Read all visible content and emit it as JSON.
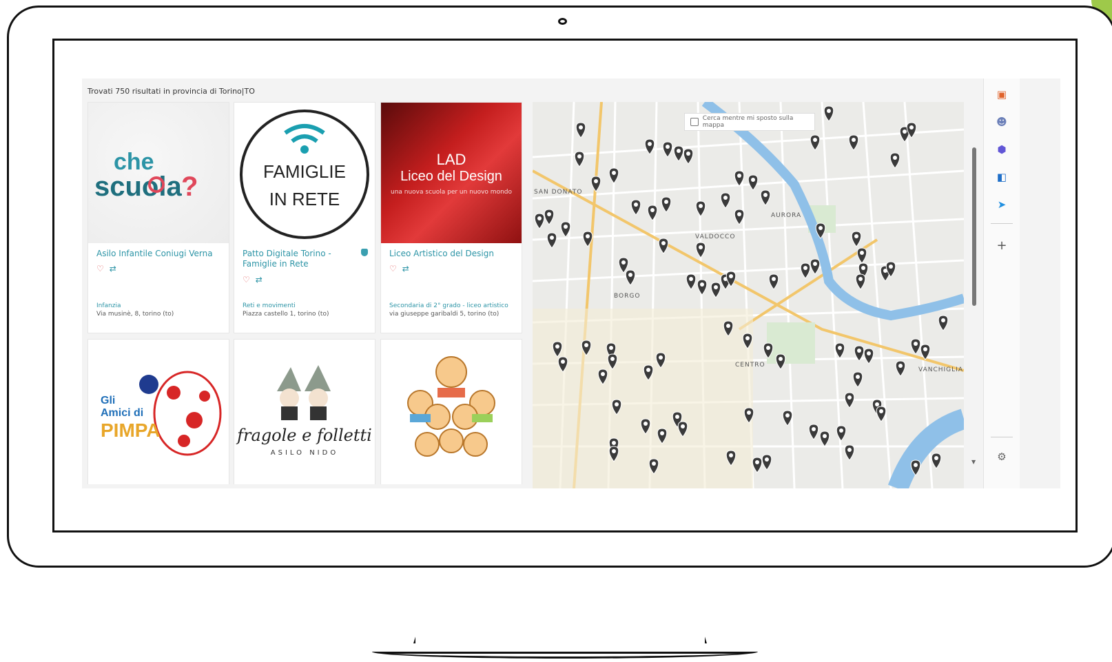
{
  "results": {
    "title": "Trovati 750 risultati in provincia di Torino|TO"
  },
  "cards": [
    {
      "title": "Asilo Infantile Coniugi Verna",
      "likes": "♡",
      "shares": "⇄",
      "category": "Infanzia",
      "address": "Via musinè, 8, torino (to)",
      "logo_text": "che scuola?"
    },
    {
      "title": "Patto Digitale Torino - Famiglie in Rete",
      "likes": "♡",
      "shares": "⇄",
      "category": "Reti e movimenti",
      "address": "Piazza castello 1, torino (to)",
      "logo_line1": "FAMIGLIE",
      "logo_line2": "IN RETE"
    },
    {
      "title": "Liceo Artistico del Design",
      "likes": "♡",
      "shares": "⇄",
      "category": "Secondaria di 2° grado - liceo artistico",
      "address": "via giuseppe garibaldi 5, torino (to)",
      "logo_line1": "LAD",
      "logo_line2": "Liceo del Design",
      "logo_line3": "una nuova scuola per un nuovo mondo"
    },
    {
      "logo_line1": "Gli",
      "logo_line2": "Amici di",
      "logo_line3": "PIMPA"
    },
    {
      "logo_line1": "fragole e folletti",
      "logo_line2": "ASILO NIDO"
    },
    {
      "logo_line1": ""
    }
  ],
  "map": {
    "search_label": "Cerca mentre mi sposto sulla mappa",
    "labels": [
      "SAN DONATO",
      "AURORA",
      "VALDOCCO",
      "CENTRO",
      "VANCHIGLIA",
      "BORGO"
    ]
  },
  "sidebar": {
    "icons": [
      "briefcase-icon",
      "people-icon",
      "hexagon-icon",
      "outlook-icon",
      "send-icon"
    ],
    "add_label": "+",
    "settings_icon": "⚙"
  },
  "colors": {
    "accent": "#2c94a6",
    "pin": "#3a3a3a",
    "deco_green": "#9ec94a"
  }
}
